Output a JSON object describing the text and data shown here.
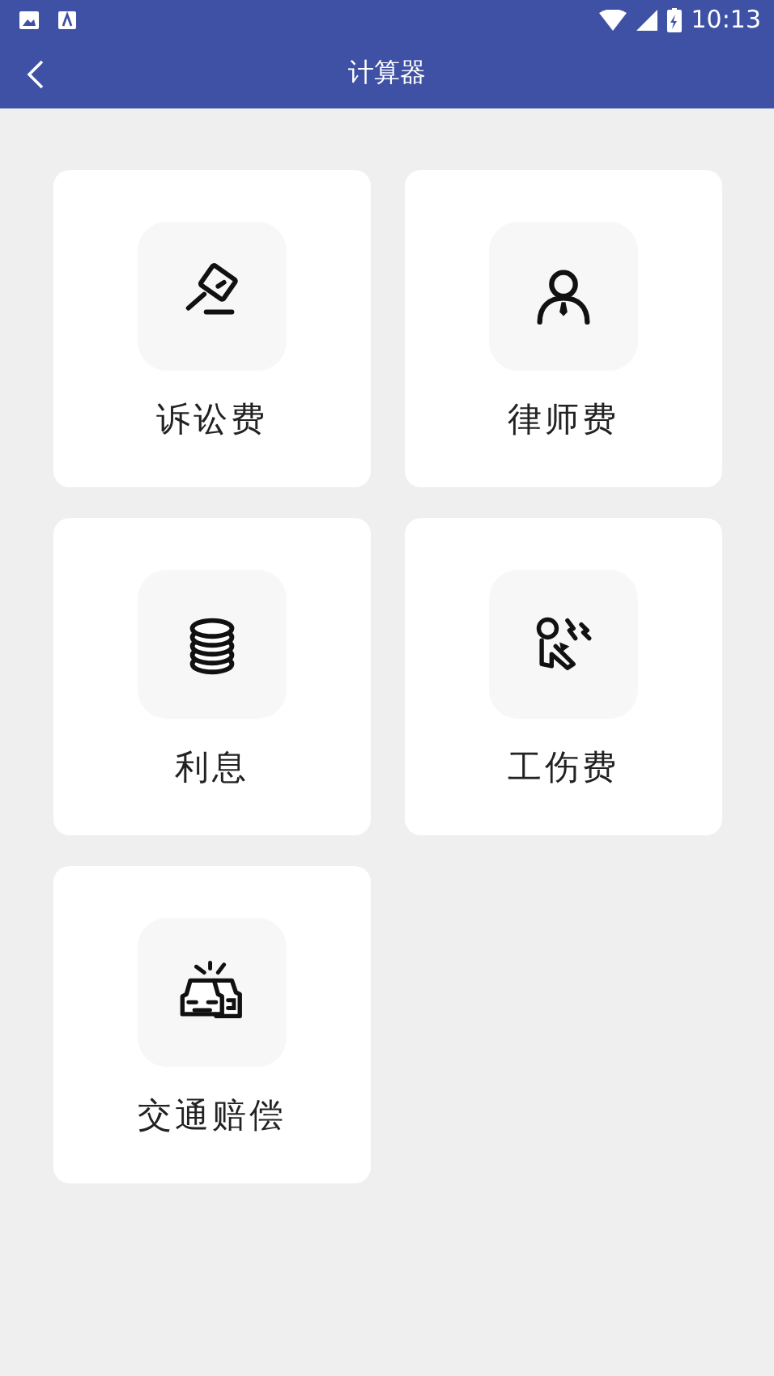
{
  "status_bar": {
    "time": "10:13"
  },
  "app_bar": {
    "title": "计算器"
  },
  "calculators": [
    {
      "label": "诉讼费"
    },
    {
      "label": "律师费"
    },
    {
      "label": "利息"
    },
    {
      "label": "工伤费"
    },
    {
      "label": "交通赔偿"
    }
  ]
}
